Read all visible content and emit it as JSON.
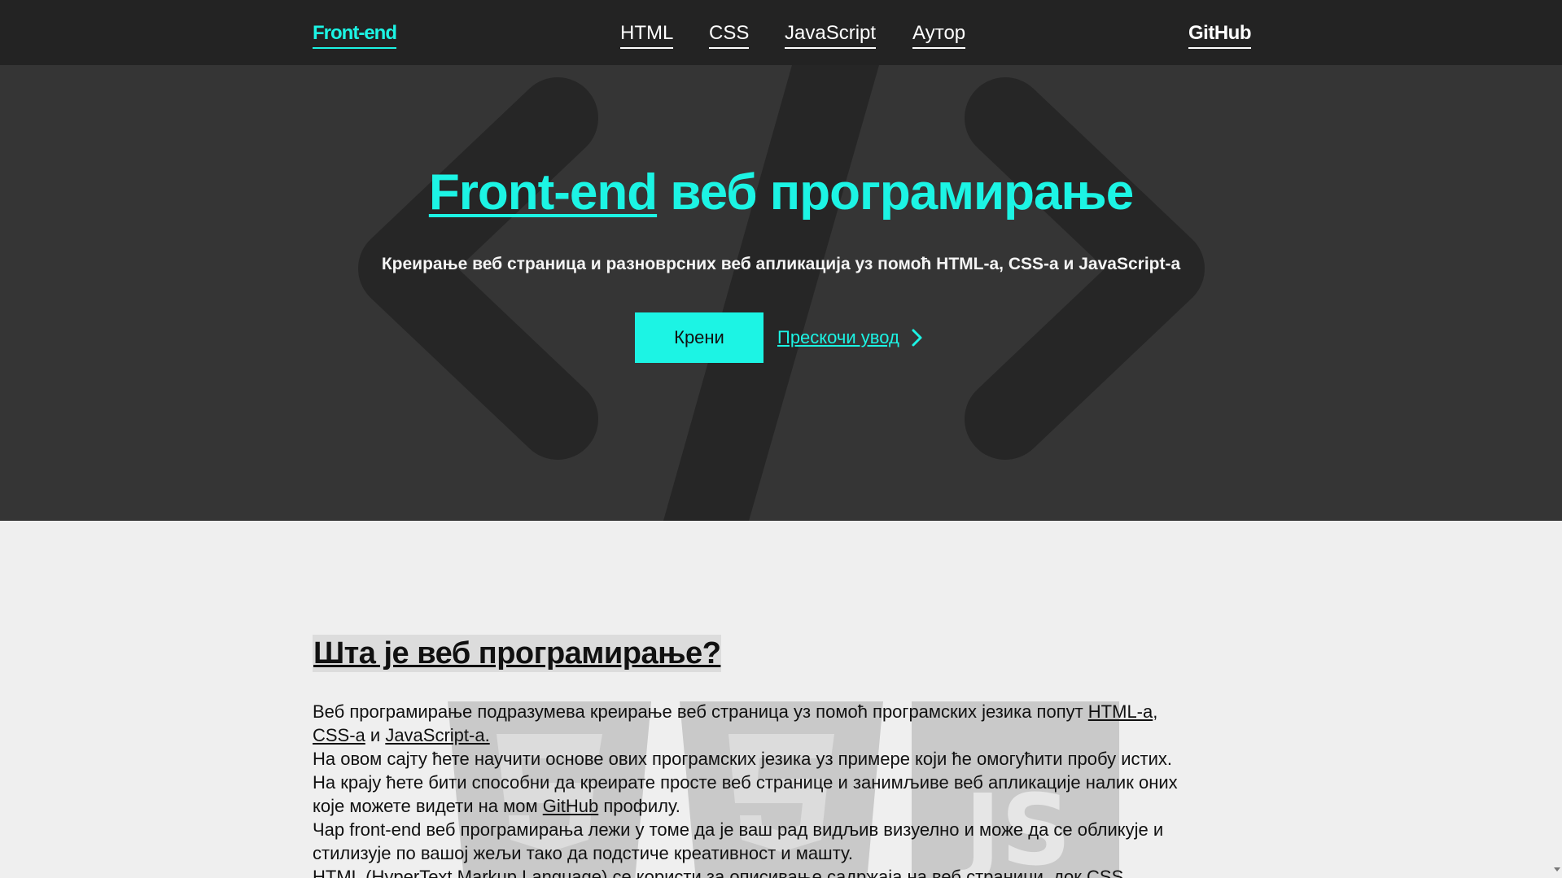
{
  "nav": {
    "brand": "Front-end",
    "links": [
      "HTML",
      "CSS",
      "JavaScript",
      "Аутор"
    ],
    "github": "GitHub"
  },
  "hero": {
    "title_link": "Front-end",
    "title_rest": " веб програмирање",
    "subtitle": "Креирање веб страница и разноврсних веб апликација уз помоћ HTML-a, CSS-a и JavaScript-a",
    "start_button": "Крени",
    "skip_link": "Прескочи увод"
  },
  "section": {
    "title": "Шта је веб програмирање?",
    "line1_a": "Веб програмирање подразумева креирање веб страница уз помоћ програмских језика попут ",
    "line1_link": "HTML-a",
    "line1_b": ",",
    "line2_link1": "CSS-a",
    "line2_mid": " и ",
    "line2_link2": "JavaScript-a.",
    "line3": "На овом сајту ћете научити основе ових програмских језика уз примере који ће омогућити пробу истих.",
    "line4": "На крају ћете бити способни да креирате просте веб странице и занимљиве веб апликације налик оних",
    "line5_a": "које можете видети на мом ",
    "line5_link": "GitHub",
    "line5_b": " профилу.",
    "line6": "Чар front-end веб програмирања лежи у томе да је ваш рад видљив визуелно и може да се обликује и",
    "line7": "стилизује по вашој жељи тако да подстиче креативност и машту.",
    "line8": "HTML (HyperText Markup Language) се користи за описивање садржаја на веб страници, док CSS"
  },
  "colors": {
    "accent": "#1cf4e4",
    "nav_bg": "#232323",
    "hero_bg": "#353535",
    "content_bg": "#efefef"
  },
  "icons": {
    "skip": "chevron-right-icon",
    "hero_background": "code-brackets-icon",
    "content_background": "html-css-js-logos-icon"
  }
}
